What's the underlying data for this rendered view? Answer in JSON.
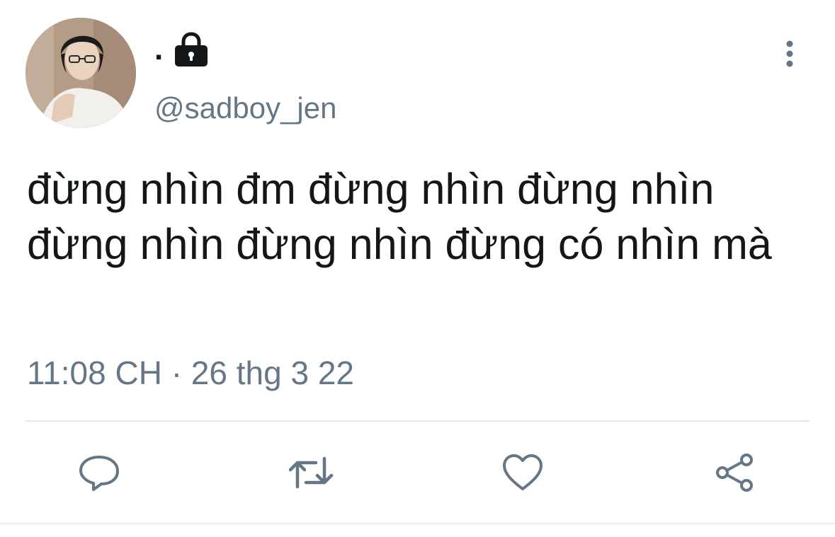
{
  "author": {
    "display_name": ".",
    "handle": "@sadboy_jen",
    "protected": true
  },
  "tweet": {
    "text": "đừng nhìn đm đừng nhìn đừng nhìn đừng nhìn đừng nhìn đừng có nhìn mà",
    "timestamp": "11:08 CH · 26 thg 3 22"
  },
  "icons": {
    "lock": "lock-icon",
    "more": "more-vertical-icon",
    "reply": "reply-icon",
    "retweet": "retweet-icon",
    "like": "heart-icon",
    "share": "share-icon"
  },
  "colors": {
    "text_primary": "#14171a",
    "text_secondary": "#657786",
    "divider": "#e1e8ed"
  }
}
